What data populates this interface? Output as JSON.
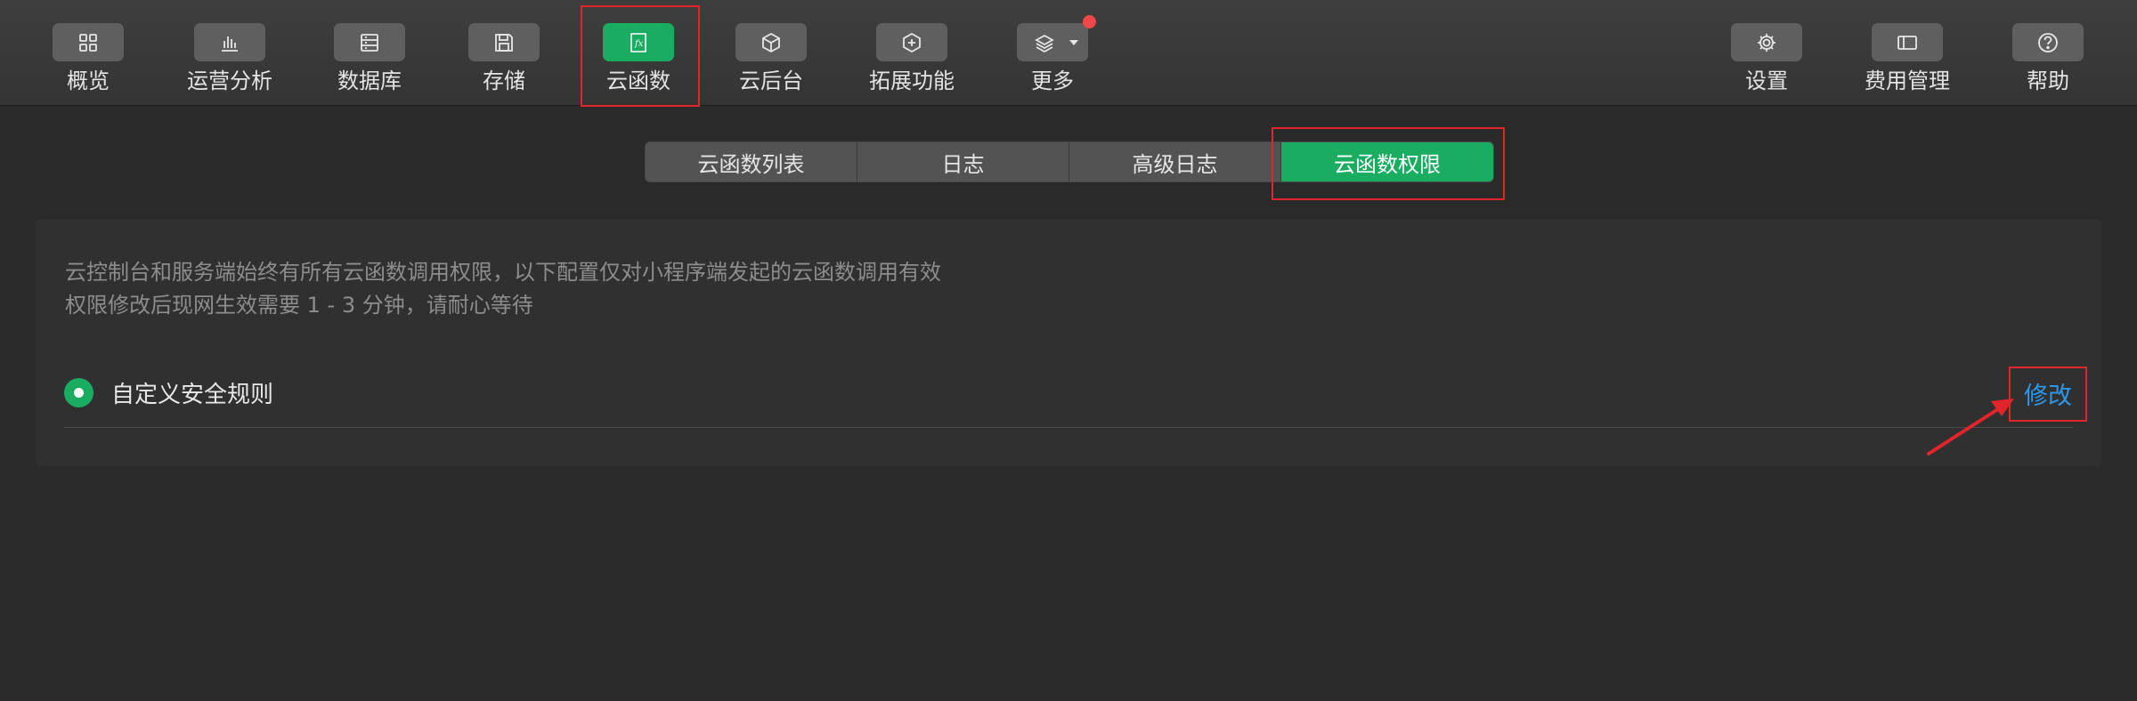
{
  "toolbar": {
    "left_items": [
      {
        "label": "概览",
        "icon": "overview-grid-icon"
      },
      {
        "label": "运营分析",
        "icon": "bar-chart-icon"
      },
      {
        "label": "数据库",
        "icon": "database-list-icon"
      },
      {
        "label": "存储",
        "icon": "floppy-disk-icon"
      },
      {
        "label": "云函数",
        "icon": "fx-function-icon",
        "active": true
      },
      {
        "label": "云后台",
        "icon": "cube-icon"
      },
      {
        "label": "拓展功能",
        "icon": "extension-plus-icon"
      },
      {
        "label": "更多",
        "icon": "layers-icon",
        "has_dropdown": true,
        "has_notification": true
      }
    ],
    "right_items": [
      {
        "label": "设置",
        "icon": "gear-icon"
      },
      {
        "label": "费用管理",
        "icon": "billing-card-icon"
      },
      {
        "label": "帮助",
        "icon": "help-circle-icon"
      }
    ]
  },
  "tabs": [
    {
      "label": "云函数列表",
      "active": false
    },
    {
      "label": "日志",
      "active": false
    },
    {
      "label": "高级日志",
      "active": false
    },
    {
      "label": "云函数权限",
      "active": true
    }
  ],
  "panel": {
    "description_line1": "云控制台和服务端始终有所有云函数调用权限，以下配置仅对小程序端发起的云函数调用有效",
    "description_line2": "权限修改后现网生效需要 1 - 3 分钟，请耐心等待",
    "rule_option_label": "自定义安全规则",
    "rule_option_selected": true,
    "edit_label": "修改"
  },
  "colors": {
    "accent_green": "#1aad61",
    "link_blue": "#2c97ea",
    "highlight_red": "#e0252c",
    "notification_red": "#f04848"
  }
}
